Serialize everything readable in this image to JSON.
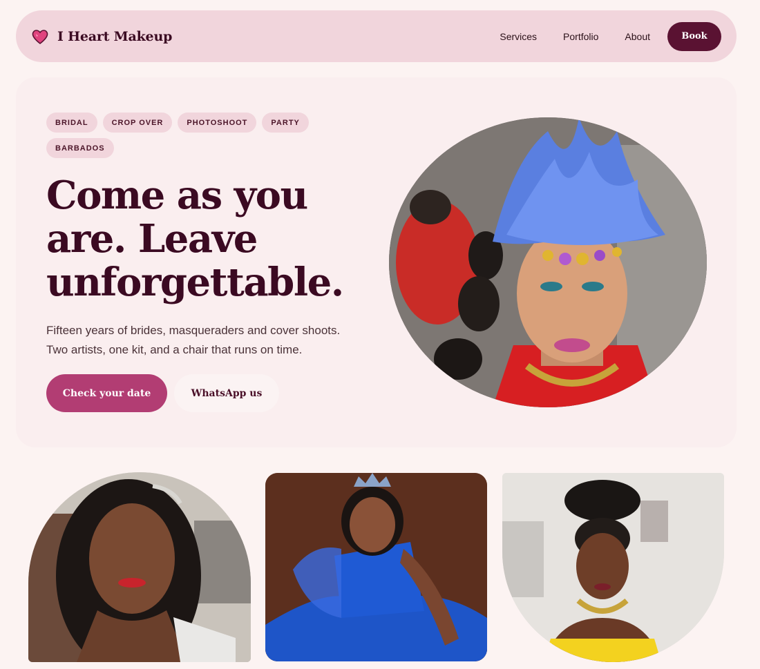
{
  "brand": {
    "name": "I Heart Makeup",
    "logo_icon": "heart-icon",
    "logo_color": "#e0447e"
  },
  "nav": {
    "links": [
      "Services",
      "Portfolio",
      "About"
    ],
    "cta": "Book"
  },
  "hero": {
    "tags": [
      "BRIDAL",
      "CROP OVER",
      "PHOTOSHOOT",
      "PARTY",
      "BARBADOS"
    ],
    "headline": "Come as you are. Leave unforgettable.",
    "subtitle": "Fifteen years of brides, masqueraders and cover shoots. Two artists, one kit, and a chair that runs on time.",
    "cta_primary": "Check your date",
    "cta_secondary": "WhatsApp us"
  },
  "colors": {
    "page_bg": "#fcf3f2",
    "nav_bg": "#f1d5dc",
    "hero_bg": "#faeeef",
    "accent_dark": "#5a1232",
    "accent_pink": "#b23d73",
    "text_dark": "#3b0a22"
  }
}
